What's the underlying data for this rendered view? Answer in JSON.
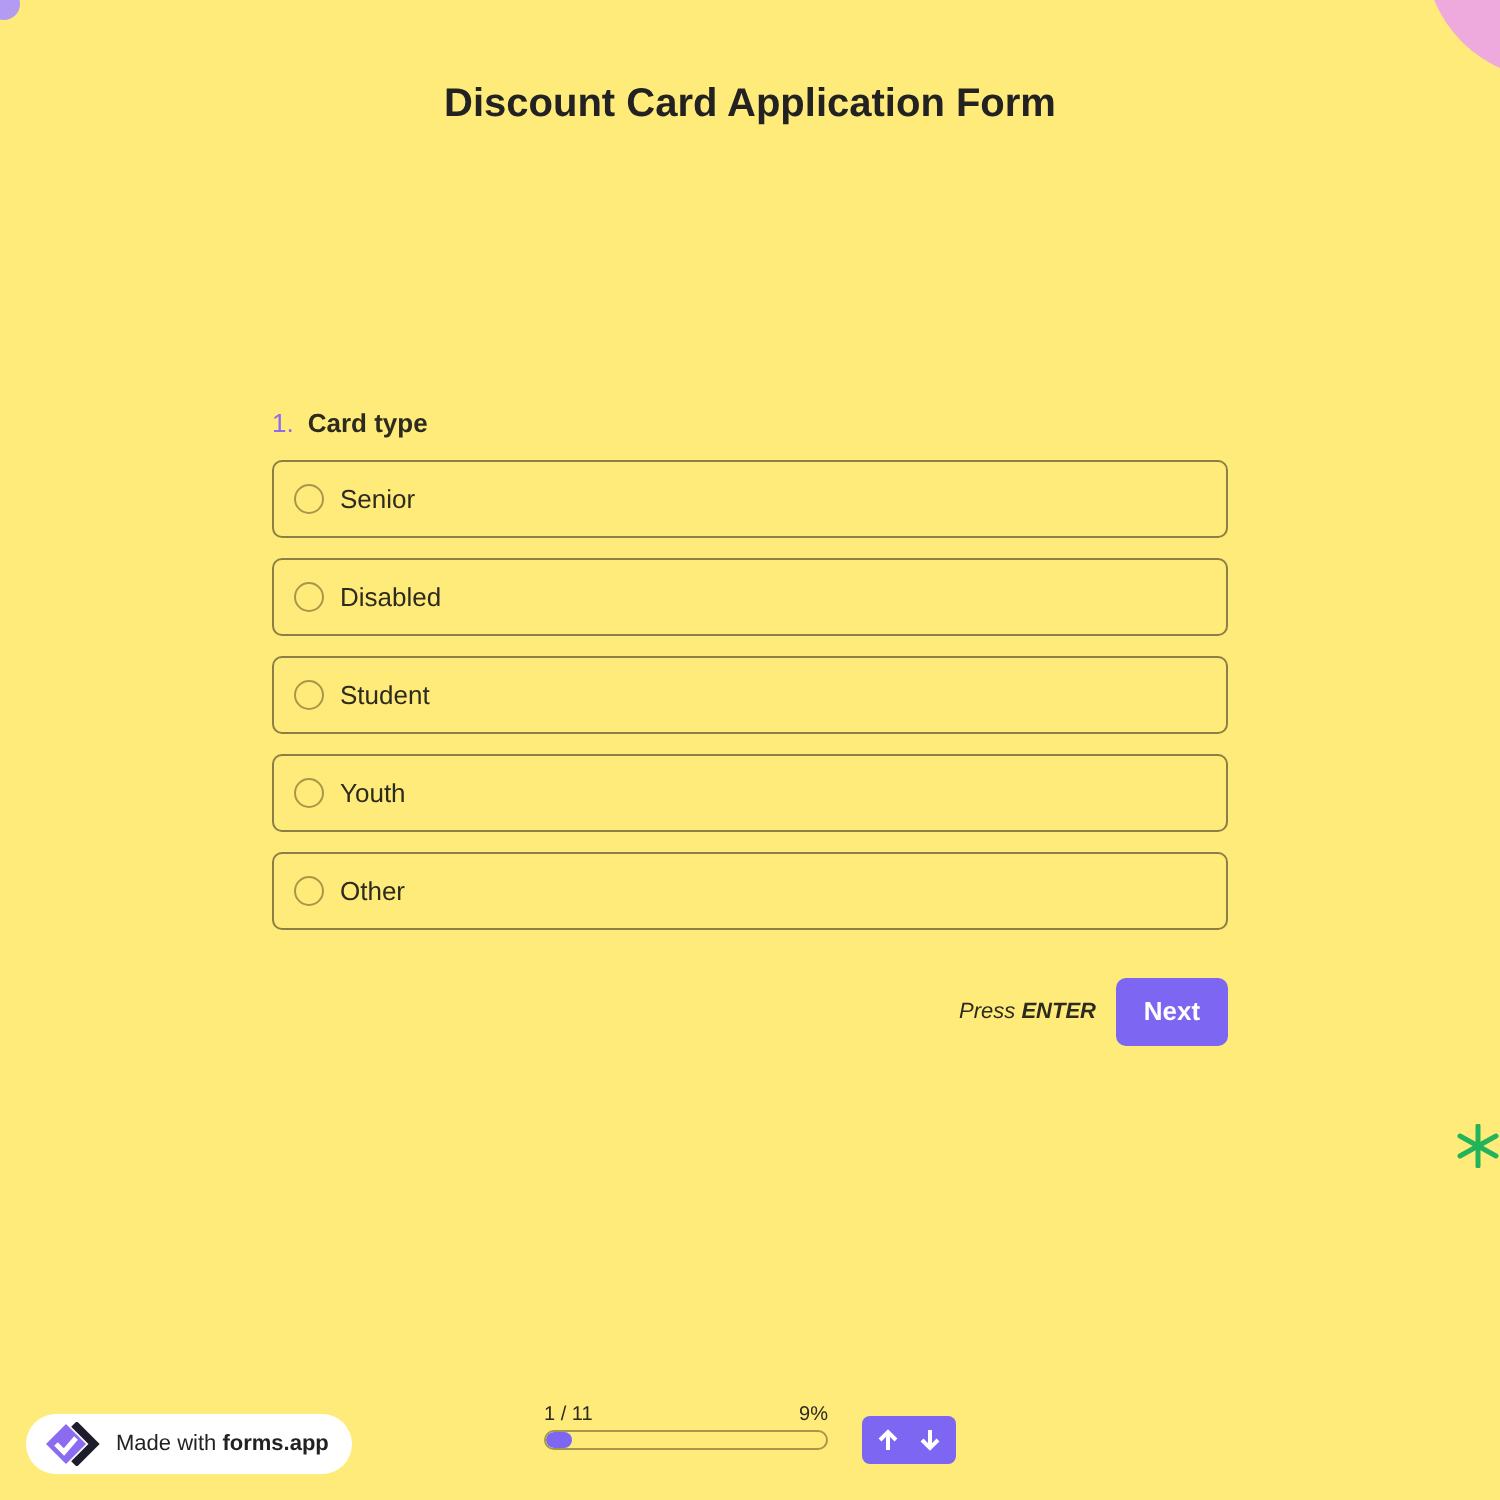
{
  "title": "Discount Card Application Form",
  "question": {
    "number": "1.",
    "label": "Card type",
    "options": [
      {
        "label": "Senior",
        "selected": false
      },
      {
        "label": "Disabled",
        "selected": false
      },
      {
        "label": "Student",
        "selected": false
      },
      {
        "label": "Youth",
        "selected": false
      },
      {
        "label": "Other",
        "selected": false
      }
    ]
  },
  "hint": "Press **ENTER**",
  "next_button": "Next",
  "badge": {
    "text": "Made with **forms.app**"
  },
  "progress": {
    "count": "1 / 11",
    "percent": "9%",
    "level": 0.09
  }
}
